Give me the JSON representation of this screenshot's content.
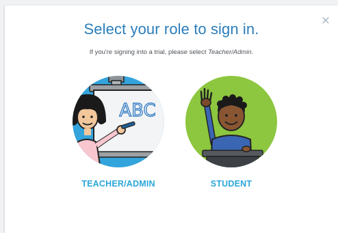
{
  "dialog": {
    "close_icon": "close-icon",
    "close_glyph": "×",
    "title": "Select your role to sign in.",
    "subtitle_prefix": "If you're signing into a trial, please select ",
    "subtitle_emphasis": "Teacher/Admin",
    "subtitle_suffix": "."
  },
  "roles": [
    {
      "label": "TEACHER/ADMIN",
      "board_text": "ABC",
      "illustration": "teacher-at-whiteboard-icon",
      "circle_color": "#34a4dc"
    },
    {
      "label": "STUDENT",
      "illustration": "student-raising-hand-icon",
      "circle_color": "#8dc63f"
    }
  ],
  "colors": {
    "title": "#2a7dbb",
    "role_label": "#2ba6d9"
  }
}
